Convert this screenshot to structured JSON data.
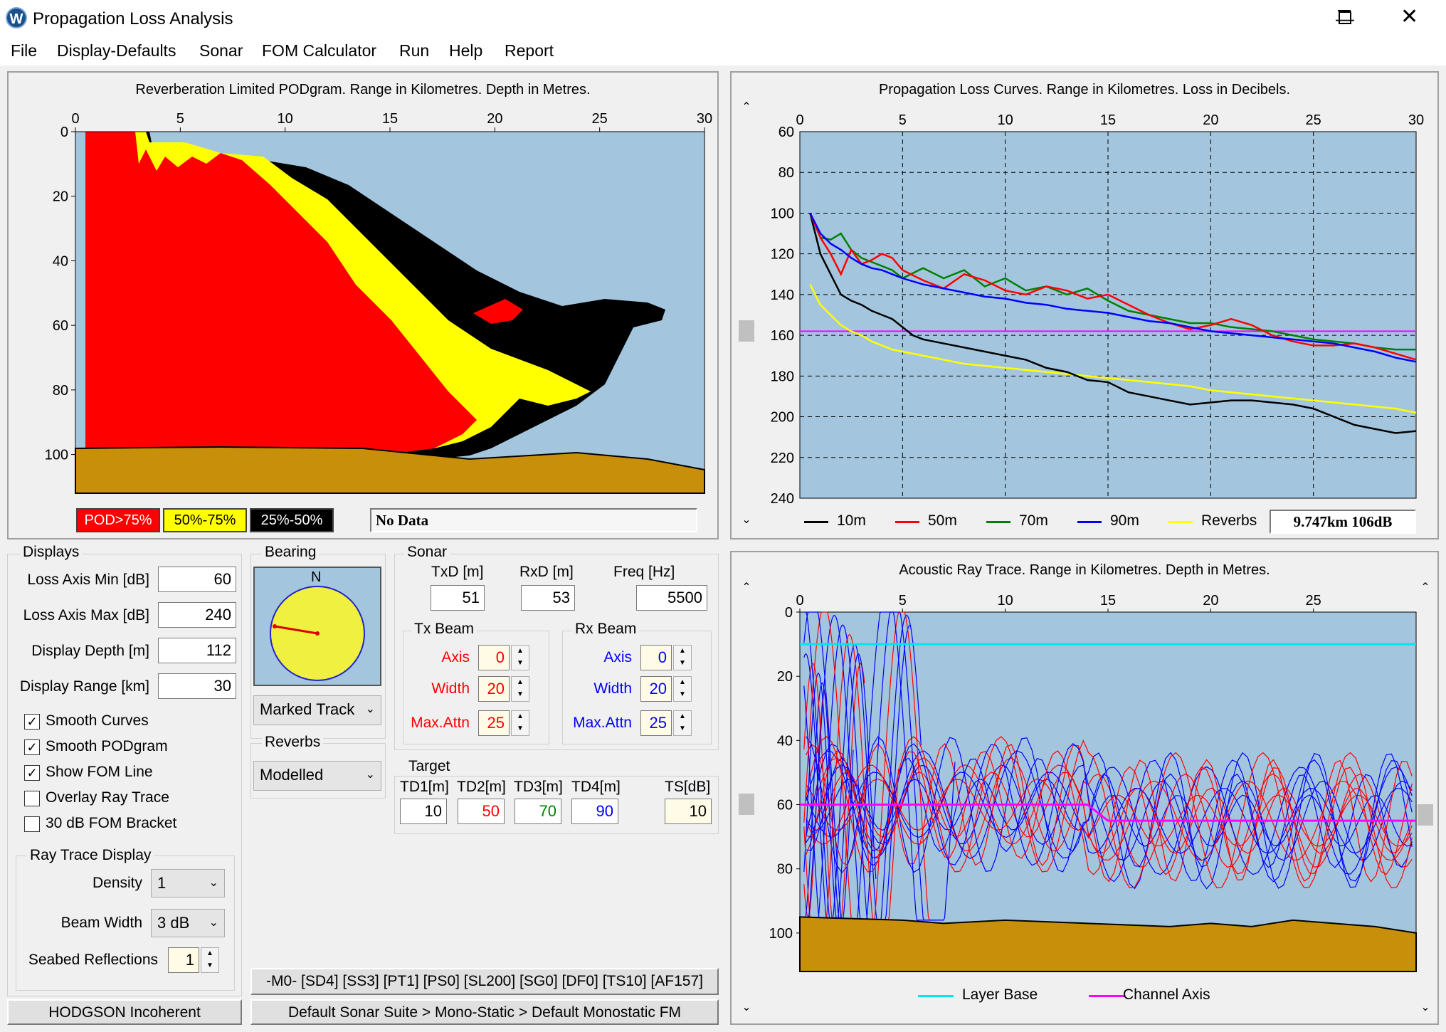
{
  "window": {
    "title": "Propagation Loss Analysis",
    "icon": "W"
  },
  "menu": [
    "File",
    "Display-Defaults",
    "Sonar",
    "FOM Calculator",
    "Run",
    "Help",
    "Report"
  ],
  "podgram": {
    "title": "Reverberation Limited PODgram. Range in Kilometres. Depth in Metres.",
    "x_ticks": [
      "0",
      "5",
      "10",
      "15",
      "20",
      "25",
      "30"
    ],
    "y_ticks": [
      "0",
      "20",
      "40",
      "60",
      "80",
      "100"
    ],
    "legend": [
      {
        "label": "POD>75%",
        "bg": "#ff0000",
        "fg": "#ffffff"
      },
      {
        "label": "50%-75%",
        "bg": "#ffff00",
        "fg": "#000000"
      },
      {
        "label": "25%-50%",
        "bg": "#000000",
        "fg": "#ffffff"
      }
    ],
    "status": "No Data",
    "colors": {
      "water": "#a3c6de",
      "seabed": "#c8900a",
      "red": "#ff0000",
      "yellow": "#ffff00",
      "black": "#000000"
    }
  },
  "loss_chart": {
    "title": "Propagation Loss Curves. Range in Kilometres. Loss in Decibels.",
    "legend_readout": "9.747km 106dB"
  },
  "chart_data": [
    {
      "type": "line",
      "title": "Propagation Loss Curves. Range in Kilometres. Loss in Decibels.",
      "xlim": [
        0,
        30
      ],
      "ylim": [
        60,
        240
      ],
      "y_inverted": true,
      "x_ticks": [
        "0",
        "5",
        "10",
        "15",
        "20",
        "25",
        "30"
      ],
      "y_ticks": [
        "60",
        "80",
        "100",
        "120",
        "140",
        "160",
        "180",
        "200",
        "220",
        "240"
      ],
      "grid": true,
      "fom_line": 158,
      "series": [
        {
          "name": "10m",
          "color": "#000000",
          "x": [
            0.5,
            1,
            1.5,
            2,
            2.5,
            3,
            3.5,
            4,
            4.5,
            5,
            5.5,
            6,
            7,
            8,
            9,
            10,
            11,
            12,
            13,
            14,
            15,
            16,
            17,
            18,
            19,
            20,
            21,
            22,
            23,
            24,
            25,
            26,
            27,
            28,
            29,
            30
          ],
          "y": [
            100,
            120,
            130,
            140,
            143,
            145,
            148,
            150,
            152,
            156,
            160,
            162,
            164,
            166,
            168,
            170,
            172,
            176,
            178,
            182,
            183,
            188,
            190,
            192,
            194,
            193,
            192,
            192,
            193,
            194,
            196,
            200,
            204,
            206,
            208,
            207
          ]
        },
        {
          "name": "50m",
          "color": "#ff0000",
          "x": [
            0.5,
            1,
            1.5,
            2,
            2.5,
            3,
            3.5,
            4,
            4.5,
            5,
            6,
            7,
            8,
            9,
            10,
            11,
            12,
            13,
            14,
            15,
            16,
            17,
            18,
            19,
            20,
            21,
            22,
            23,
            24,
            25,
            26,
            27,
            28,
            29,
            30
          ],
          "y": [
            100,
            112,
            120,
            130,
            118,
            125,
            123,
            120,
            122,
            128,
            133,
            137,
            130,
            133,
            138,
            140,
            136,
            138,
            142,
            140,
            145,
            150,
            154,
            157,
            155,
            152,
            155,
            160,
            163,
            165,
            165,
            164,
            166,
            169,
            172
          ]
        },
        {
          "name": "70m",
          "color": "#008000",
          "x": [
            0.5,
            1,
            1.5,
            2,
            2.5,
            3,
            3.5,
            4,
            4.5,
            5,
            6,
            7,
            8,
            9,
            10,
            11,
            12,
            13,
            14,
            15,
            16,
            17,
            18,
            19,
            20,
            21,
            22,
            23,
            24,
            25,
            26,
            27,
            28,
            29,
            30
          ],
          "y": [
            100,
            112,
            113,
            110,
            118,
            122,
            124,
            126,
            128,
            132,
            127,
            132,
            128,
            136,
            132,
            138,
            136,
            140,
            137,
            143,
            148,
            150,
            152,
            154,
            154,
            156,
            157,
            158,
            160,
            162,
            163,
            164,
            166,
            167,
            167
          ]
        },
        {
          "name": "90m",
          "color": "#0000ff",
          "x": [
            0.5,
            1,
            1.5,
            2,
            2.5,
            3,
            3.5,
            4,
            4.5,
            5,
            6,
            7,
            8,
            9,
            10,
            11,
            12,
            13,
            14,
            15,
            16,
            17,
            18,
            19,
            20,
            21,
            22,
            23,
            24,
            25,
            26,
            27,
            28,
            29,
            30
          ],
          "y": [
            100,
            110,
            115,
            118,
            122,
            125,
            127,
            128,
            130,
            132,
            135,
            137,
            139,
            141,
            142,
            144,
            145,
            147,
            148,
            149,
            151,
            153,
            154,
            156,
            158,
            159,
            160,
            161,
            162,
            163,
            164,
            166,
            168,
            171,
            173
          ]
        },
        {
          "name": "Reverbs",
          "color": "#ffff00",
          "x": [
            0.5,
            1,
            1.5,
            2,
            2.5,
            3,
            3.5,
            4,
            4.5,
            5,
            6,
            7,
            8,
            9,
            10,
            11,
            12,
            13,
            14,
            15,
            16,
            17,
            18,
            19,
            20,
            21,
            22,
            23,
            24,
            25,
            26,
            27,
            28,
            29,
            30
          ],
          "y": [
            135,
            145,
            150,
            155,
            158,
            160,
            163,
            165,
            167,
            168,
            170,
            172,
            174,
            175,
            176,
            177,
            178,
            179,
            180,
            181,
            182,
            183,
            184,
            185,
            187,
            188,
            189,
            190,
            191,
            192,
            193,
            194,
            195,
            196,
            198
          ]
        }
      ]
    },
    {
      "type": "line",
      "title": "Acoustic Ray Trace. Range in Kilometres. Depth in Metres.",
      "xlim": [
        0,
        30
      ],
      "ylim": [
        0,
        112
      ],
      "y_inverted": true,
      "x_ticks": [
        "0",
        "5",
        "10",
        "15",
        "20",
        "25"
      ],
      "y_ticks": [
        "0",
        "20",
        "40",
        "60",
        "80",
        "100"
      ],
      "series": [
        {
          "name": "Layer Base",
          "color": "#00e5ee",
          "x": [
            0,
            30
          ],
          "y": [
            10,
            10
          ]
        },
        {
          "name": "Channel Axis",
          "color": "#ff00ff",
          "x": [
            0,
            14,
            15,
            30
          ],
          "y": [
            60,
            60,
            65,
            65
          ]
        }
      ]
    }
  ],
  "raytrace": {
    "title": "Acoustic Ray Trace. Range in Kilometres. Depth in Metres.",
    "legend": [
      {
        "label": "Layer Base",
        "color": "#00e5ee"
      },
      {
        "label": "Channel Axis",
        "color": "#ff00ff"
      }
    ]
  },
  "displays": {
    "group_label": "Displays",
    "fields": [
      {
        "label": "Loss Axis Min [dB]",
        "value": "60"
      },
      {
        "label": "Loss Axis Max [dB]",
        "value": "240"
      },
      {
        "label": "Display Depth [m]",
        "value": "112"
      },
      {
        "label": "Display Range [km]",
        "value": "30"
      }
    ],
    "checkboxes": [
      {
        "label": "Smooth Curves",
        "checked": true
      },
      {
        "label": "Smooth PODgram",
        "checked": true
      },
      {
        "label": "Show FOM Line",
        "checked": true
      },
      {
        "label": "Overlay Ray Trace",
        "checked": false
      },
      {
        "label": "30 dB FOM Bracket",
        "checked": false
      }
    ],
    "raytrace_display": {
      "group_label": "Ray Trace Display",
      "density_label": "Density",
      "density_value": "1",
      "beamwidth_label": "Beam Width",
      "beamwidth_value": "3 dB",
      "seabed_label": "Seabed Reflections",
      "seabed_value": "1"
    }
  },
  "bearing": {
    "group_label": "Bearing",
    "north": "N",
    "mode": "Marked Track"
  },
  "reverbs": {
    "group_label": "Reverbs",
    "mode": "Modelled"
  },
  "sonar": {
    "group_label": "Sonar",
    "txd_label": "TxD [m]",
    "txd": "51",
    "rxd_label": "RxD [m]",
    "rxd": "53",
    "freq_label": "Freq [Hz]",
    "freq": "5500",
    "tx_beam": {
      "label": "Tx Beam",
      "axis_label": "Axis",
      "axis": "0",
      "width_label": "Width",
      "width": "20",
      "maxattn_label": "Max.Attn",
      "maxattn": "25",
      "color": "#ff0000"
    },
    "rx_beam": {
      "label": "Rx Beam",
      "axis_label": "Axis",
      "axis": "0",
      "width_label": "Width",
      "width": "20",
      "maxattn_label": "Max.Attn",
      "maxattn": "25",
      "color": "#0000ff"
    }
  },
  "target": {
    "group_label": "Target",
    "td1_label": "TD1[m]",
    "td1": "10",
    "td2_label": "TD2[m]",
    "td2": "50",
    "td3_label": "TD3[m]",
    "td3": "70",
    "td4_label": "TD4[m]",
    "td4": "90",
    "ts_label": "TS[dB]",
    "ts": "10"
  },
  "status": {
    "params": "-M0-  [SD4] [SS3] [PT1] [PS0] [SL200] [SG0] [DF0] [TS10] [AF157]",
    "model": "HODGSON Incoherent",
    "suite": "Default Sonar Suite > Mono-Static > Default Monostatic FM"
  }
}
